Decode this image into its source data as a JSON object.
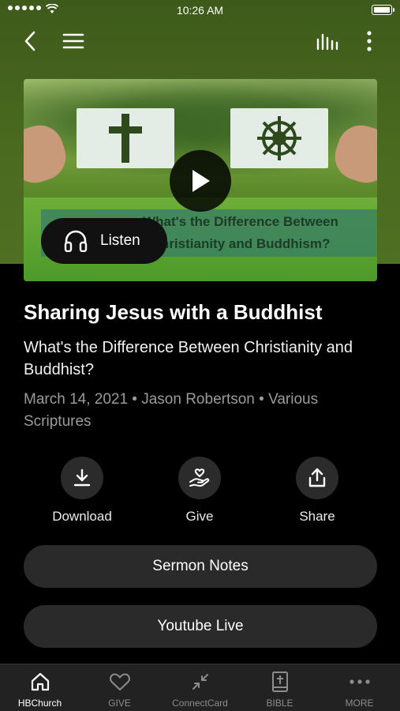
{
  "status_bar": {
    "time": "10:26 AM"
  },
  "nav": {
    "back_icon": "chevron-left-icon",
    "menu_icon": "hamburger-icon",
    "equalizer_icon": "equalizer-icon",
    "more_icon": "vertical-dots-icon"
  },
  "artwork": {
    "banner_line1": "What's the Difference Between",
    "banner_line2": "Christianity and Buddhism?",
    "play_icon": "play-icon"
  },
  "listen": {
    "label": "Listen",
    "icon": "headphones-icon"
  },
  "sermon": {
    "title": "Sharing Jesus with a Buddhist",
    "subtitle": "What's the Difference Between Christianity and Buddhist?",
    "meta": "March 14, 2021 • Jason Robertson • Various Scriptures"
  },
  "actions": [
    {
      "label": "Download",
      "icon": "download-icon"
    },
    {
      "label": "Give",
      "icon": "give-hand-heart-icon"
    },
    {
      "label": "Share",
      "icon": "share-icon"
    }
  ],
  "buttons": {
    "sermon_notes": "Sermon Notes",
    "youtube_live": "Youtube Live"
  },
  "tabs": [
    {
      "label": "HBChurch",
      "icon": "home-icon",
      "active": true
    },
    {
      "label": "GIVE",
      "icon": "heart-icon",
      "active": false
    },
    {
      "label": "ConnectCard",
      "icon": "compress-arrows-icon",
      "active": false
    },
    {
      "label": "BIBLE",
      "icon": "bible-icon",
      "active": false
    },
    {
      "label": "MORE",
      "icon": "horizontal-dots-icon",
      "active": false
    }
  ]
}
